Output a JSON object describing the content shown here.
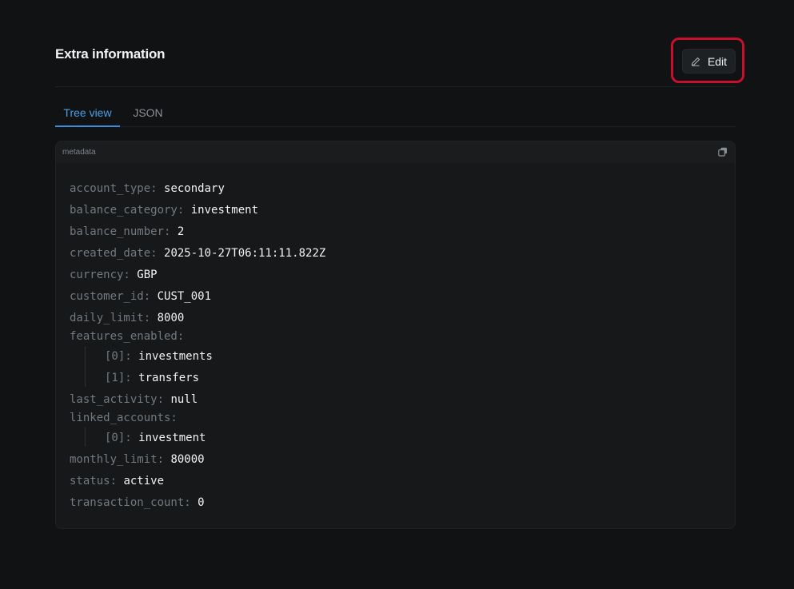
{
  "header": {
    "title": "Extra information",
    "edit_label": "Edit"
  },
  "tabs": [
    {
      "label": "Tree view",
      "active": true
    },
    {
      "label": "JSON",
      "active": false
    }
  ],
  "panel": {
    "label": "metadata"
  },
  "tree": {
    "account_type": {
      "key": "account_type:",
      "value": "secondary"
    },
    "balance_category": {
      "key": "balance_category:",
      "value": "investment"
    },
    "balance_number": {
      "key": "balance_number:",
      "value": "2"
    },
    "created_date": {
      "key": "created_date:",
      "value": "2025-10-27T06:11:11.822Z"
    },
    "currency": {
      "key": "currency:",
      "value": "GBP"
    },
    "customer_id": {
      "key": "customer_id:",
      "value": "CUST_001"
    },
    "daily_limit": {
      "key": "daily_limit:",
      "value": "8000"
    },
    "features_enabled": {
      "key": "features_enabled:",
      "items": [
        {
          "key": "[0]:",
          "value": "investments"
        },
        {
          "key": "[1]:",
          "value": "transfers"
        }
      ]
    },
    "last_activity": {
      "key": "last_activity:",
      "value": "null"
    },
    "linked_accounts": {
      "key": "linked_accounts:",
      "items": [
        {
          "key": "[0]:",
          "value": "investment"
        }
      ]
    },
    "monthly_limit": {
      "key": "monthly_limit:",
      "value": "80000"
    },
    "status": {
      "key": "status:",
      "value": "active"
    },
    "transaction_count": {
      "key": "transaction_count:",
      "value": "0"
    }
  },
  "colors": {
    "accent": "#3b8ddb",
    "highlight": "#c8102e",
    "background": "#111213"
  }
}
